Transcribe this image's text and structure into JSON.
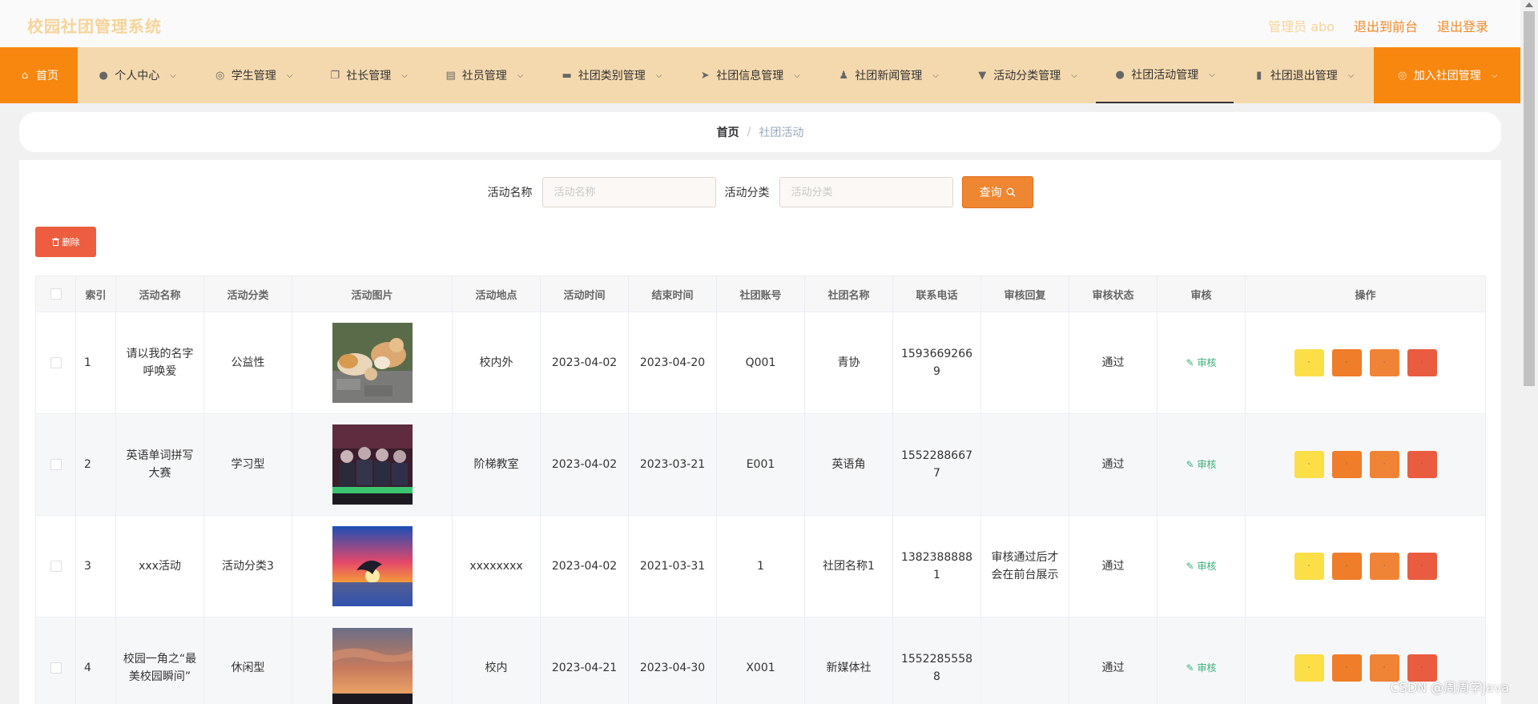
{
  "header": {
    "title": "校园社团管理系统",
    "admin": "管理员 abo",
    "links": [
      "退出到前台",
      "退出登录"
    ]
  },
  "nav": [
    {
      "label": "首页",
      "icon": "home-icon"
    },
    {
      "label": "个人中心",
      "icon": "user-icon"
    },
    {
      "label": "学生管理",
      "icon": "compass-icon"
    },
    {
      "label": "社长管理",
      "icon": "copy-icon"
    },
    {
      "label": "社员管理",
      "icon": "clipboard-icon"
    },
    {
      "label": "社团类别管理",
      "icon": "monitor-icon"
    },
    {
      "label": "社团信息管理",
      "icon": "send-icon"
    },
    {
      "label": "社团新闻管理",
      "icon": "person-icon"
    },
    {
      "label": "活动分类管理",
      "icon": "stamp-icon"
    },
    {
      "label": "社团活动管理",
      "icon": "bulb-icon"
    },
    {
      "label": "社团退出管理",
      "icon": "bar-chart-icon"
    },
    {
      "label": "加入社团管理",
      "icon": "help-icon"
    }
  ],
  "breadcrumb": {
    "home": "首页",
    "separator": "/",
    "current": "社团活动"
  },
  "search": {
    "name_label": "活动名称",
    "name_placeholder": "活动名称",
    "category_label": "活动分类",
    "category_placeholder": "活动分类",
    "query_label": "查询"
  },
  "delete_label": "删除",
  "table": {
    "columns": [
      "索引",
      "活动名称",
      "活动分类",
      "活动图片",
      "活动地点",
      "活动时间",
      "结束时间",
      "社团账号",
      "社团名称",
      "联系电话",
      "审核回复",
      "审核状态",
      "审核",
      "操作"
    ],
    "audit_action": "审核",
    "op_buttons": [
      "·",
      "·",
      "·",
      "·"
    ],
    "rows": [
      {
        "index": "1",
        "name": "请以我的名字呼唤爱",
        "category": "公益性",
        "image": "cats",
        "location": "校内外",
        "start": "2023-04-02",
        "end": "2023-04-20",
        "account": "Q001",
        "club": "青协",
        "phone": "15936692669",
        "reply": "",
        "status": "通过"
      },
      {
        "index": "2",
        "name": "英语单词拼写大赛",
        "category": "学习型",
        "image": "classroom",
        "location": "阶梯教室",
        "start": "2023-04-02",
        "end": "2023-03-21",
        "account": "E001",
        "club": "英语角",
        "phone": "15522886677",
        "reply": "",
        "status": "通过"
      },
      {
        "index": "3",
        "name": "xxx活动",
        "category": "活动分类3",
        "image": "dolphin",
        "location": "xxxxxxxx",
        "start": "2023-04-02",
        "end": "2021-03-31",
        "account": "1",
        "club": "社团名称1",
        "phone": "13823888881",
        "reply": "审核通过后才会在前台展示",
        "status": "通过"
      },
      {
        "index": "4",
        "name": "校园一角之“最美校园瞬间”",
        "category": "休闲型",
        "image": "sunset",
        "location": "校内",
        "start": "2023-04-21",
        "end": "2023-04-30",
        "account": "X001",
        "club": "新媒体社",
        "phone": "15522855588",
        "reply": "",
        "status": "通过"
      }
    ]
  },
  "watermark": "CSDN @周周学Java"
}
